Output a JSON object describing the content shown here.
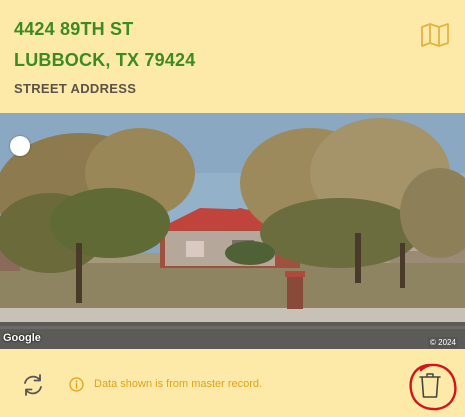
{
  "address": {
    "line1": "4424 89TH ST",
    "line2": "LUBBOCK, TX 79424",
    "type_label": "STREET ADDRESS"
  },
  "icons": {
    "map": "map-icon",
    "refresh": "refresh-icon",
    "info": "info-icon",
    "delete": "trash-icon"
  },
  "street_view": {
    "attribution": "Google",
    "copyright": "© 2024"
  },
  "footer": {
    "info_text": "Data shown is from master record."
  },
  "colors": {
    "background": "#feeaa8",
    "address_green": "#3d8a23",
    "accent_orange": "#e3a21a",
    "annotation_red": "#d4141c"
  }
}
